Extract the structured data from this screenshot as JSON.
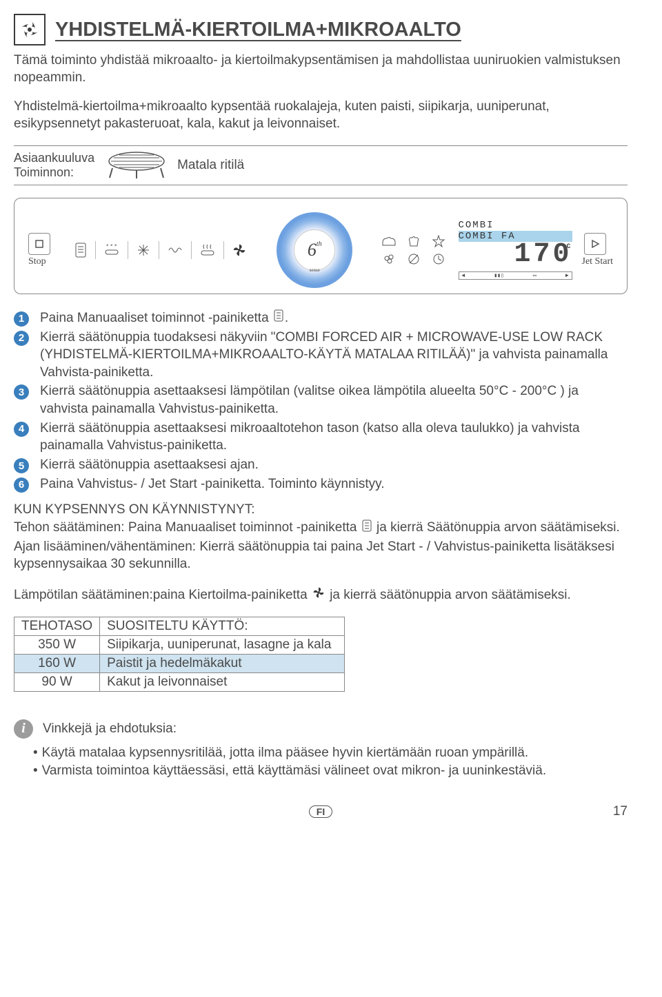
{
  "header": {
    "title": "YHDISTELMÄ-KIERTOILMA+MIKROAALTO"
  },
  "intro": {
    "p1": "Tämä toiminto yhdistää mikroaalto- ja kiertoilmakypsentämisen ja mahdollistaa uuniruokien valmistuksen nopeammin.",
    "p2": "Yhdistelmä-kiertoilma+mikroaalto kypsentää ruokalajeja, kuten paisti, siipikarja, uuniperunat, esikypsennetyt pakasteruoat, kala, kakut ja leivonnaiset."
  },
  "accessory": {
    "label1": "Asiaankuuluva",
    "label2": "Toiminnon:",
    "name": "Matala ritilä"
  },
  "panel": {
    "stop": "Stop",
    "jet": "Jet Start",
    "knob_six": "6",
    "knob_sup": "th",
    "knob_sense": "sense",
    "lcd_line1": "COMBI",
    "lcd_line2": "COMBI FA",
    "lcd_value": "170",
    "lcd_unit": "°C"
  },
  "steps": {
    "s1_a": "Paina Manuaaliset toiminnot -painiketta ",
    "s1_b": ".",
    "s2": "Kierrä säätönuppia tuodaksesi näkyviin \"COMBI FORCED AIR + MICROWAVE-USE LOW RACK (YHDISTELMÄ-KIERTOILMA+MIKROAALTO-KÄYTÄ MATALAA RITILÄÄ)\" ja vahvista painamalla Vahvista-painiketta.",
    "s3": "Kierrä säätönuppia asettaaksesi lämpötilan (valitse oikea lämpötila alueelta 50°C - 200°C ) ja vahvista painamalla Vahvistus-painiketta.",
    "s4": "Kierrä säätönuppia asettaaksesi mikroaaltotehon tason (katso alla oleva taulukko) ja vahvista painamalla Vahvistus-painiketta.",
    "s5": "Kierrä säätönuppia  asettaaksesi ajan.",
    "s6": "Paina Vahvistus- / Jet Start -painiketta. Toiminto käynnistyy."
  },
  "running": {
    "heading": "KUN KYPSENNYS ON KÄYNNISTYNYT:",
    "line1_a": "Tehon säätäminen: Paina Manuaaliset toiminnot -painiketta ",
    "line1_b": " ja kierrä Säätönuppia arvon säätämiseksi.",
    "line2": "Ajan lisääminen/vähentäminen: Kierrä säätönuppia tai paina Jet Start - / Vahvistus-painiketta lisätäksesi kypsennysaikaa 30 sekunnilla.",
    "line3_a": "Lämpötilan säätäminen:paina Kiertoilma-painiketta ",
    "line3_b": " ja kierrä säätönuppia arvon säätämiseksi."
  },
  "table": {
    "h1": "TEHOTASO",
    "h2": "SUOSITELTU KÄYTTÖ:",
    "r1c1": "350 W",
    "r1c2": "Siipikarja, uuniperunat, lasagne ja kala",
    "r2c1": "160 W",
    "r2c2": "Paistit ja hedelmäkakut",
    "r3c1": "90 W",
    "r3c2": "Kakut ja leivonnaiset"
  },
  "tips": {
    "heading": "Vinkkejä ja ehdotuksia:",
    "b1": "Käytä matalaa kypsennysritilää, jotta ilma pääsee hyvin kiertämään ruoan ympärillä.",
    "b2": "Varmista toimintoa käyttäessäsi, että käyttämäsi välineet ovat mikron- ja uuninkestäviä."
  },
  "footer": {
    "lang": "FI",
    "page": "17"
  }
}
